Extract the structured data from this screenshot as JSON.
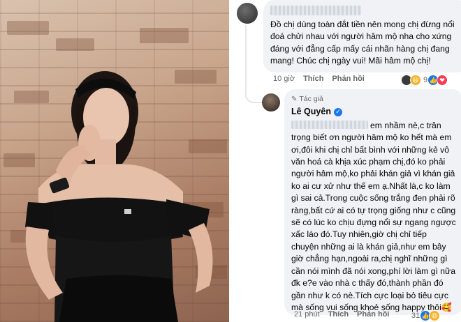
{
  "comment1": {
    "text": "Đồ chị dùng toàn đắt tiền nên mong chị đừng nổi đoá chửi nhau với người hâm mộ nha cho xứng đáng với đẳng cấp mấy cái nhãn hàng chị đang mang! Chúc chị ngày vui! Mãi hâm mộ chị!",
    "time": "10 giờ",
    "like_label": "Thích",
    "reply_label": "Phản hồi",
    "reaction_count": "9",
    "reaction_icons": [
      "user-avatar-icon",
      "haha-icon",
      "like-icon",
      "love-icon"
    ]
  },
  "comment2": {
    "author_badge": "Tác giả",
    "author_name": "Lê Quyên",
    "text": "em nhầm nè,c trân trọng biết ơn người hâm mộ ko hết mà em ơi,đôi khi chị chỉ bất bình với những kẻ vô văn hoá cà khịa xúc phạm chị,đó ko phải người hâm mộ,ko phải khán giả vì khán giả ko ai cư xử như thế em ạ.Nhất là,c ko làm gì sai cả.Trong cuộc sống trắng đen phải rõ ràng,bất cứ ai có tự trọng giống như c cũng sẽ có lúc ko chịu đựng nổi sự ngang ngược xấc láo đó.Tuy nhiên,giờ chị chỉ tiếp chuyện những ai là khán giả,như em bây giờ chẳng hạn,ngoài ra,chị nghĩ những gì cần nói mình đã nói xong,phí lời làm gì nữa đk e?e vào nhà c thấy đó,thành phần đó gần như k có nè.Tích cực loại bỏ tiêu cực mà sống vui sống khoẻ sống happy thôi🥰",
    "time": "21 phút",
    "like_label": "Thích",
    "reply_label": "Phản hồi",
    "reaction_count": "31",
    "reaction_icons": [
      "like-icon",
      "haha-icon"
    ]
  },
  "colors": {
    "bubble": "#f0f2f5",
    "meta": "#65676b",
    "verified": "#1877f2"
  }
}
